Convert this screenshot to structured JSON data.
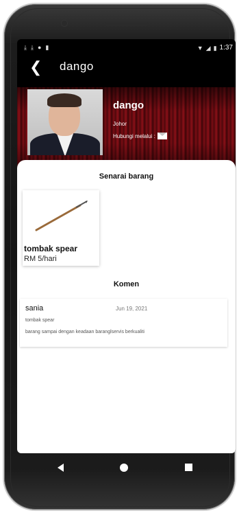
{
  "status_bar": {
    "left_icons": [
      "download-icon",
      "download-icon",
      "record-icon",
      "clipboard-icon"
    ],
    "right_icons": [
      "wifi-icon",
      "signal-icon",
      "battery-icon"
    ],
    "time": "1:37"
  },
  "app_bar": {
    "back_icon": "arrow-back-icon",
    "title": "dango"
  },
  "profile": {
    "name": "dango",
    "location": "Johor",
    "contact_label": "Hubungi melalui :",
    "contact_icon": "mail-icon"
  },
  "items_section": {
    "title": "Senarai barang",
    "items": [
      {
        "name": "tombak spear",
        "price": "RM 5/hari"
      }
    ]
  },
  "comments_section": {
    "title": "Komen",
    "comments": [
      {
        "user": "sania",
        "date": "Jun 19, 2021",
        "item": "tombak spear",
        "text": "barang sampai dengan keadaan baranglservis berkualiti"
      }
    ]
  },
  "nav_bar": {
    "back": "nav-back-icon",
    "home": "nav-home-icon",
    "recent": "nav-recent-icon"
  },
  "colors": {
    "header_red": "#8c1018",
    "frame": "#1c1c1c"
  }
}
